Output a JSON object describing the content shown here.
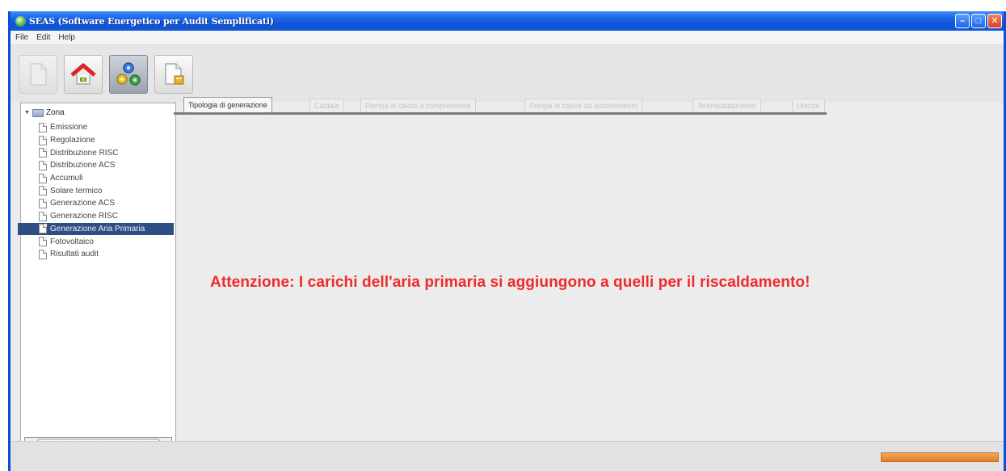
{
  "window": {
    "title": "SEAS (Software Energetico per Audit Semplificati)",
    "controls": {
      "minimize": "–",
      "maximize": "□",
      "close": "✕"
    }
  },
  "menu": [
    "File",
    "Edit",
    "Help"
  ],
  "toolbar": {
    "buttons": [
      {
        "icon": "blank-document-icon",
        "state": "disabled"
      },
      {
        "icon": "home-icon",
        "state": "normal"
      },
      {
        "icon": "gears-icon",
        "state": "active"
      },
      {
        "icon": "edit-document-icon",
        "state": "normal"
      }
    ]
  },
  "tree": {
    "root": "Zona",
    "items": [
      "Emissione",
      "Regolazione",
      "Distribuzione RISC",
      "Distribuzione ACS",
      "Accumuli",
      "Solare termico",
      "Generazione ACS",
      "Generazione RISC",
      "Generazione Aria Primaria",
      "Fotovoltaico",
      "Risultati audit"
    ],
    "selected_index": 8
  },
  "tabs": [
    "Tipologia di generazione",
    "Caldaia",
    "Pompa di calore a compressione",
    "Pompa di calore ad assorbimento",
    "Teleriscaldamento",
    "Utenze"
  ],
  "active_tab_index": 0,
  "content": {
    "warning": "Attenzione: I carichi dell'aria primaria si aggiungono a quelli per il riscaldamento!"
  },
  "colors": {
    "warning": "#ee2b2b",
    "selection": "#2e4e86",
    "titlebar": "#1a63e6",
    "progress": "#e8892f"
  }
}
